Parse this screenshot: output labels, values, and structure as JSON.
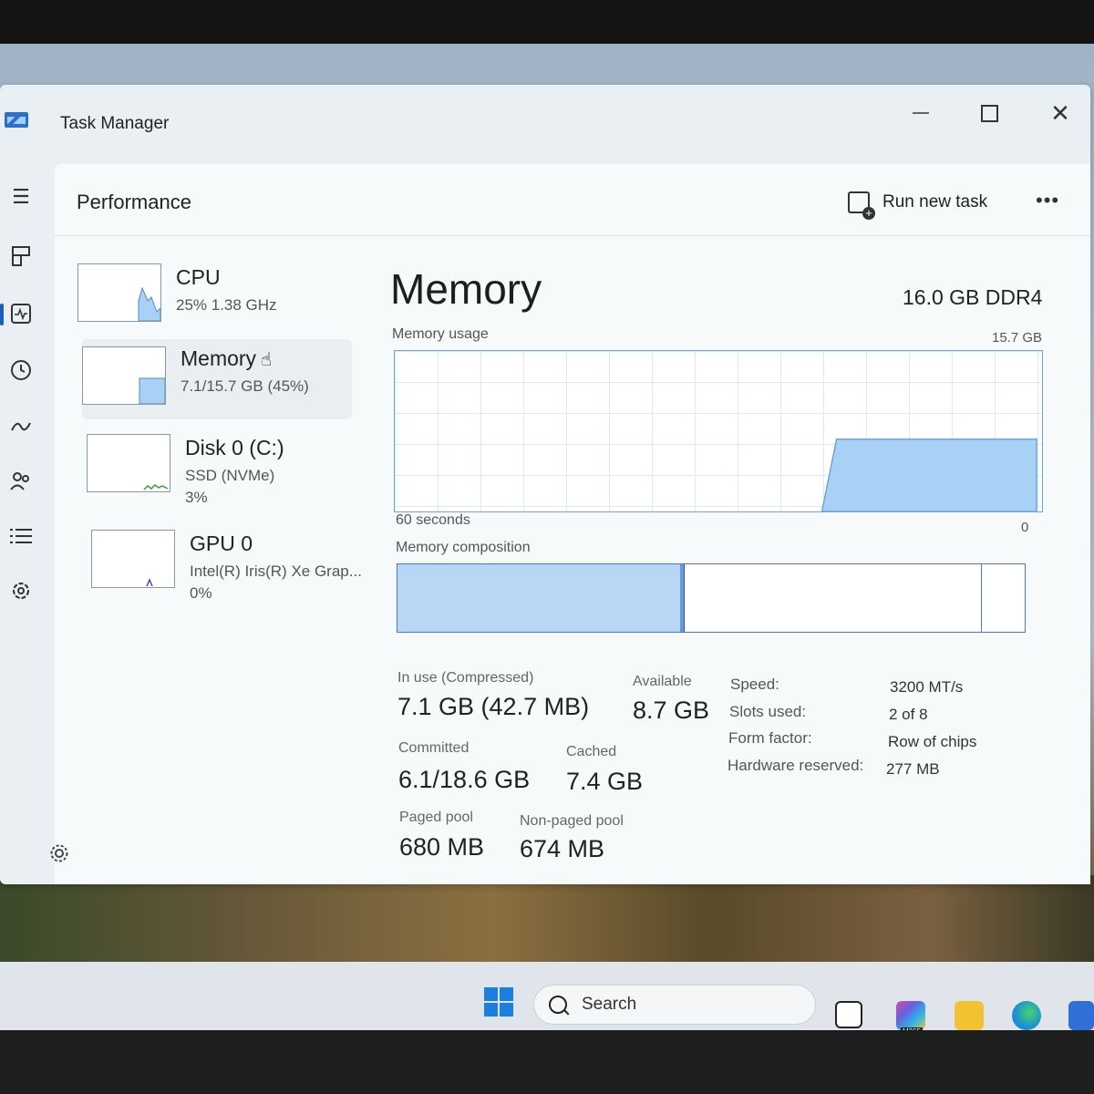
{
  "window": {
    "title": "Task Manager"
  },
  "header": {
    "title": "Performance",
    "run_new_task": "Run new task",
    "more": "•••"
  },
  "nav_rail": [
    {
      "icon": "hamburger-icon"
    },
    {
      "icon": "processes-icon"
    },
    {
      "icon": "performance-icon",
      "active": true
    },
    {
      "icon": "app-history-icon"
    },
    {
      "icon": "startup-apps-icon"
    },
    {
      "icon": "users-icon"
    },
    {
      "icon": "details-icon"
    },
    {
      "icon": "services-icon"
    },
    {
      "icon": "settings-icon"
    }
  ],
  "resources": [
    {
      "name": "CPU",
      "line1": "25%  1.38 GHz",
      "line2": ""
    },
    {
      "name": "Memory",
      "line1": "7.1/15.7 GB (45%)",
      "line2": "",
      "selected": true
    },
    {
      "name": "Disk 0 (C:)",
      "line1": "SSD (NVMe)",
      "line2": "3%"
    },
    {
      "name": "GPU 0",
      "line1": "Intel(R) Iris(R) Xe Grap...",
      "line2": "0%"
    }
  ],
  "memory": {
    "title": "Memory",
    "type": "16.0 GB DDR4",
    "usage_label": "Memory usage",
    "max_label": "15.7 GB",
    "time_label": "60 seconds",
    "zero_label": "0",
    "composition_label": "Memory composition",
    "usage_level_fraction": 0.45,
    "composition": {
      "in_use_fraction": 0.45,
      "standby_fraction": 0.93
    },
    "stats": {
      "in_use_label": "In use (Compressed)",
      "in_use_value": "7.1 GB (42.7 MB)",
      "available_label": "Available",
      "available_value": "8.7 GB",
      "committed_label": "Committed",
      "committed_value": "6.1/18.6 GB",
      "cached_label": "Cached",
      "cached_value": "7.4 GB",
      "paged_label": "Paged pool",
      "paged_value": "680 MB",
      "nonpaged_label": "Non-paged pool",
      "nonpaged_value": "674 MB"
    },
    "details": [
      {
        "key": "Speed:",
        "value": "3200 MT/s"
      },
      {
        "key": "Slots used:",
        "value": "2 of 8"
      },
      {
        "key": "Form factor:",
        "value": "Row of chips"
      },
      {
        "key": "Hardware reserved:",
        "value": "277 MB"
      }
    ]
  },
  "taskbar": {
    "search_placeholder": "Search",
    "m365_badge": "M365"
  },
  "colors": {
    "accent": "#1d5fbd",
    "graph_fill": "#a9d0f5",
    "graph_line": "#6ea5d9",
    "composition_border": "#4e77c9"
  }
}
